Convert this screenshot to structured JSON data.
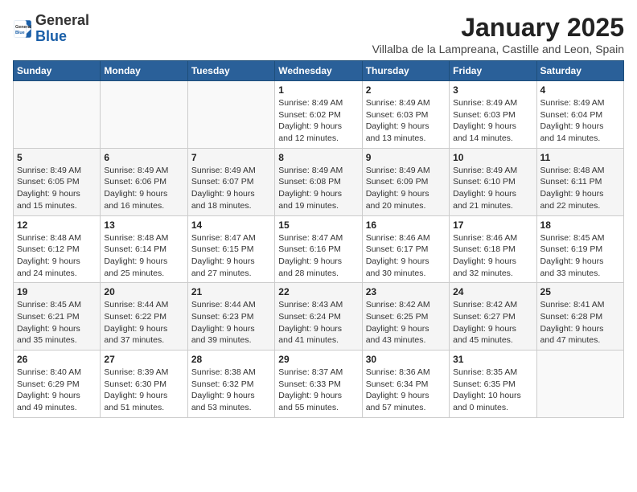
{
  "header": {
    "logo_general": "General",
    "logo_blue": "Blue",
    "month_title": "January 2025",
    "subtitle": "Villalba de la Lampreana, Castille and Leon, Spain"
  },
  "weekdays": [
    "Sunday",
    "Monday",
    "Tuesday",
    "Wednesday",
    "Thursday",
    "Friday",
    "Saturday"
  ],
  "weeks": [
    [
      {
        "day": "",
        "info": ""
      },
      {
        "day": "",
        "info": ""
      },
      {
        "day": "",
        "info": ""
      },
      {
        "day": "1",
        "info": "Sunrise: 8:49 AM\nSunset: 6:02 PM\nDaylight: 9 hours\nand 12 minutes."
      },
      {
        "day": "2",
        "info": "Sunrise: 8:49 AM\nSunset: 6:03 PM\nDaylight: 9 hours\nand 13 minutes."
      },
      {
        "day": "3",
        "info": "Sunrise: 8:49 AM\nSunset: 6:03 PM\nDaylight: 9 hours\nand 14 minutes."
      },
      {
        "day": "4",
        "info": "Sunrise: 8:49 AM\nSunset: 6:04 PM\nDaylight: 9 hours\nand 14 minutes."
      }
    ],
    [
      {
        "day": "5",
        "info": "Sunrise: 8:49 AM\nSunset: 6:05 PM\nDaylight: 9 hours\nand 15 minutes."
      },
      {
        "day": "6",
        "info": "Sunrise: 8:49 AM\nSunset: 6:06 PM\nDaylight: 9 hours\nand 16 minutes."
      },
      {
        "day": "7",
        "info": "Sunrise: 8:49 AM\nSunset: 6:07 PM\nDaylight: 9 hours\nand 18 minutes."
      },
      {
        "day": "8",
        "info": "Sunrise: 8:49 AM\nSunset: 6:08 PM\nDaylight: 9 hours\nand 19 minutes."
      },
      {
        "day": "9",
        "info": "Sunrise: 8:49 AM\nSunset: 6:09 PM\nDaylight: 9 hours\nand 20 minutes."
      },
      {
        "day": "10",
        "info": "Sunrise: 8:49 AM\nSunset: 6:10 PM\nDaylight: 9 hours\nand 21 minutes."
      },
      {
        "day": "11",
        "info": "Sunrise: 8:48 AM\nSunset: 6:11 PM\nDaylight: 9 hours\nand 22 minutes."
      }
    ],
    [
      {
        "day": "12",
        "info": "Sunrise: 8:48 AM\nSunset: 6:12 PM\nDaylight: 9 hours\nand 24 minutes."
      },
      {
        "day": "13",
        "info": "Sunrise: 8:48 AM\nSunset: 6:14 PM\nDaylight: 9 hours\nand 25 minutes."
      },
      {
        "day": "14",
        "info": "Sunrise: 8:47 AM\nSunset: 6:15 PM\nDaylight: 9 hours\nand 27 minutes."
      },
      {
        "day": "15",
        "info": "Sunrise: 8:47 AM\nSunset: 6:16 PM\nDaylight: 9 hours\nand 28 minutes."
      },
      {
        "day": "16",
        "info": "Sunrise: 8:46 AM\nSunset: 6:17 PM\nDaylight: 9 hours\nand 30 minutes."
      },
      {
        "day": "17",
        "info": "Sunrise: 8:46 AM\nSunset: 6:18 PM\nDaylight: 9 hours\nand 32 minutes."
      },
      {
        "day": "18",
        "info": "Sunrise: 8:45 AM\nSunset: 6:19 PM\nDaylight: 9 hours\nand 33 minutes."
      }
    ],
    [
      {
        "day": "19",
        "info": "Sunrise: 8:45 AM\nSunset: 6:21 PM\nDaylight: 9 hours\nand 35 minutes."
      },
      {
        "day": "20",
        "info": "Sunrise: 8:44 AM\nSunset: 6:22 PM\nDaylight: 9 hours\nand 37 minutes."
      },
      {
        "day": "21",
        "info": "Sunrise: 8:44 AM\nSunset: 6:23 PM\nDaylight: 9 hours\nand 39 minutes."
      },
      {
        "day": "22",
        "info": "Sunrise: 8:43 AM\nSunset: 6:24 PM\nDaylight: 9 hours\nand 41 minutes."
      },
      {
        "day": "23",
        "info": "Sunrise: 8:42 AM\nSunset: 6:25 PM\nDaylight: 9 hours\nand 43 minutes."
      },
      {
        "day": "24",
        "info": "Sunrise: 8:42 AM\nSunset: 6:27 PM\nDaylight: 9 hours\nand 45 minutes."
      },
      {
        "day": "25",
        "info": "Sunrise: 8:41 AM\nSunset: 6:28 PM\nDaylight: 9 hours\nand 47 minutes."
      }
    ],
    [
      {
        "day": "26",
        "info": "Sunrise: 8:40 AM\nSunset: 6:29 PM\nDaylight: 9 hours\nand 49 minutes."
      },
      {
        "day": "27",
        "info": "Sunrise: 8:39 AM\nSunset: 6:30 PM\nDaylight: 9 hours\nand 51 minutes."
      },
      {
        "day": "28",
        "info": "Sunrise: 8:38 AM\nSunset: 6:32 PM\nDaylight: 9 hours\nand 53 minutes."
      },
      {
        "day": "29",
        "info": "Sunrise: 8:37 AM\nSunset: 6:33 PM\nDaylight: 9 hours\nand 55 minutes."
      },
      {
        "day": "30",
        "info": "Sunrise: 8:36 AM\nSunset: 6:34 PM\nDaylight: 9 hours\nand 57 minutes."
      },
      {
        "day": "31",
        "info": "Sunrise: 8:35 AM\nSunset: 6:35 PM\nDaylight: 10 hours\nand 0 minutes."
      },
      {
        "day": "",
        "info": ""
      }
    ]
  ]
}
